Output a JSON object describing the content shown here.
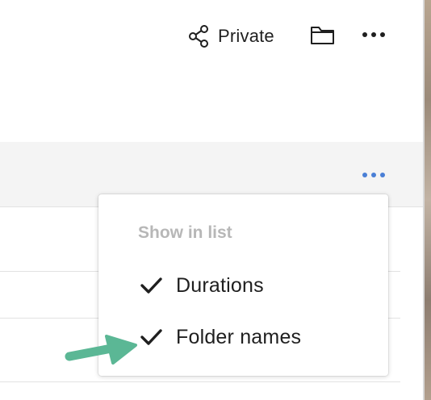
{
  "header": {
    "share_label": "Private",
    "share_icon": "share-icon",
    "folder_icon": "folder-icon",
    "more_icon": "more-horizontal-icon"
  },
  "list_header": {
    "more_icon": "more-horizontal-icon",
    "accent_color": "#4a7fd6"
  },
  "menu": {
    "heading": "Show in list",
    "items": [
      {
        "label": "Durations",
        "checked": true
      },
      {
        "label": "Folder names",
        "checked": true
      }
    ]
  },
  "annotation": {
    "arrow_color": "#5bb795"
  }
}
